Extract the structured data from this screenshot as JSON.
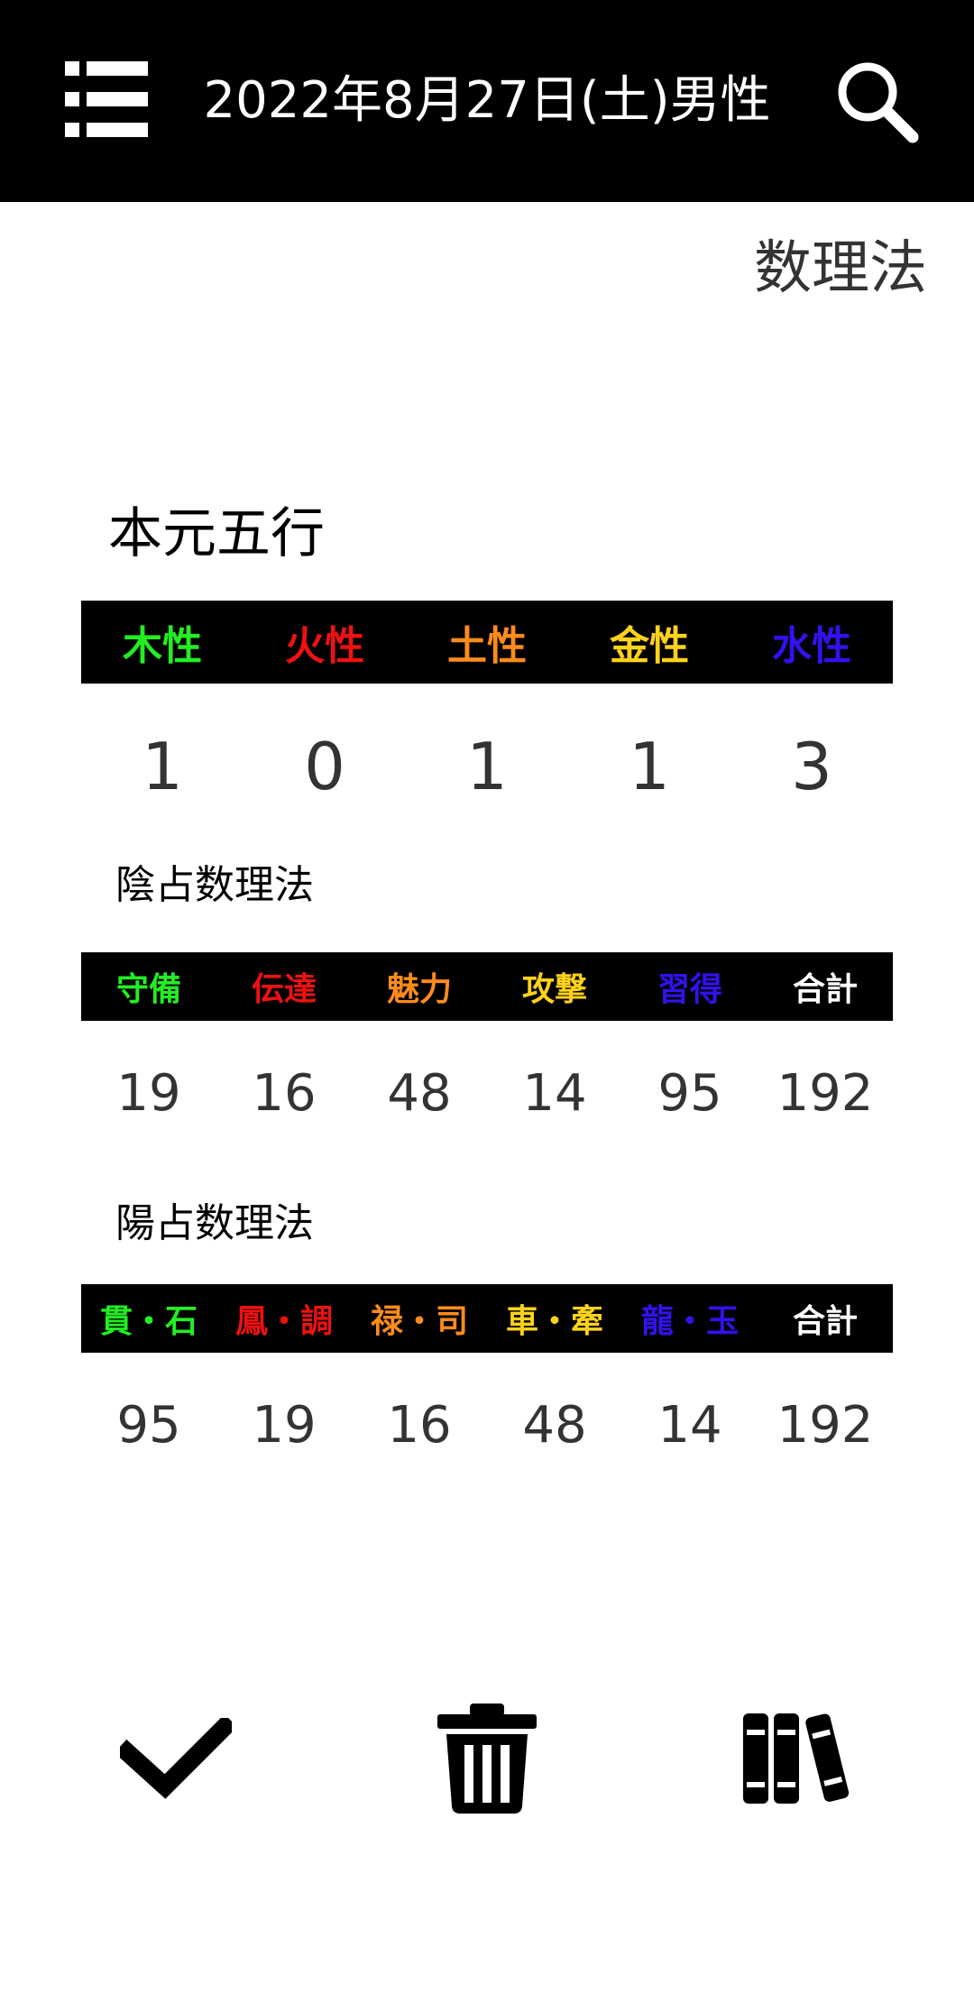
{
  "app_bar": {
    "title": "2022年8月27日(土)男性",
    "menu_icon": "list-menu-icon",
    "search_icon": "search-icon"
  },
  "page": {
    "subtitle": "数理法"
  },
  "honmoto": {
    "title": "本元五行",
    "headers": [
      {
        "label": "木性",
        "color": "#22ee22"
      },
      {
        "label": "火性",
        "color": "#ee1111"
      },
      {
        "label": "土性",
        "color": "#ff8c1a"
      },
      {
        "label": "金性",
        "color": "#ffd21a"
      },
      {
        "label": "水性",
        "color": "#3311ee"
      }
    ],
    "values": [
      "1",
      "0",
      "1",
      "1",
      "3"
    ]
  },
  "in_suri": {
    "title": "陰占数理法",
    "headers": [
      {
        "label": "守備",
        "color": "#22ee22"
      },
      {
        "label": "伝達",
        "color": "#ee1111"
      },
      {
        "label": "魅力",
        "color": "#ff8c1a"
      },
      {
        "label": "攻撃",
        "color": "#ffd21a"
      },
      {
        "label": "習得",
        "color": "#3311ee"
      },
      {
        "label": "合計",
        "color": "#ffffff"
      }
    ],
    "values": [
      "19",
      "16",
      "48",
      "14",
      "95",
      "192"
    ]
  },
  "yo_suri": {
    "title": "陽占数理法",
    "headers": [
      {
        "label": "貫・石",
        "color": "#22ee22"
      },
      {
        "label": "鳳・調",
        "color": "#ee1111"
      },
      {
        "label": "禄・司",
        "color": "#ff8c1a"
      },
      {
        "label": "車・牽",
        "color": "#ffd21a"
      },
      {
        "label": "龍・玉",
        "color": "#3311ee"
      },
      {
        "label": "合計",
        "color": "#ffffff"
      }
    ],
    "values": [
      "95",
      "19",
      "16",
      "48",
      "14",
      "192"
    ]
  },
  "bottom_bar": {
    "icons": [
      "check-icon",
      "trash-icon",
      "books-icon"
    ]
  }
}
